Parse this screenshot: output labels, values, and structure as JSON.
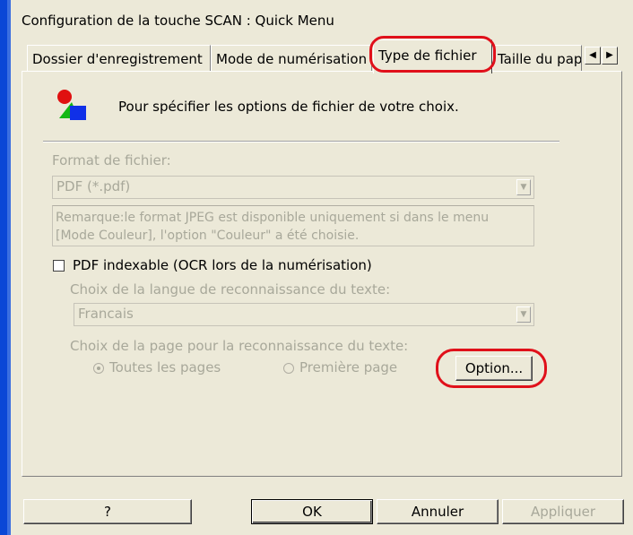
{
  "window": {
    "title": "Configuration de la touche SCAN : Quick Menu"
  },
  "tabs": [
    {
      "label": "Dossier d'enregistrement"
    },
    {
      "label": "Mode de numérisation"
    },
    {
      "label": "Type de fichier",
      "selected": true
    },
    {
      "label": "Taille du papier"
    }
  ],
  "tab_scroll": {
    "left_icon": "arrow-left-icon",
    "right_icon": "arrow-right-icon"
  },
  "panel": {
    "description": "Pour spécifier les options de fichier de votre choix.",
    "file_format": {
      "label": "Format de fichier:",
      "value": "PDF (*.pdf)",
      "enabled": false
    },
    "note": "Remarque:le format JPEG est disponible uniquement si dans le menu [Mode Couleur], l'option \"Couleur\" a été choisie.",
    "pdf_indexable": {
      "label": "PDF indexable (OCR lors de la numérisation)",
      "checked": false
    },
    "ocr_language": {
      "label": "Choix de la langue de reconnaissance du texte:",
      "value": "Francais",
      "enabled": false
    },
    "page_choice": {
      "label": "Choix de la page pour la reconnaissance du texte:",
      "options": [
        {
          "label": "Toutes les pages",
          "selected": true
        },
        {
          "label": "Première page",
          "selected": false
        }
      ],
      "enabled": false
    },
    "option_button": "Option..."
  },
  "buttons": {
    "help": "?",
    "ok": "OK",
    "cancel": "Annuler",
    "apply": "Appliquer"
  },
  "colors": {
    "dialog_bg": "#ece9d8",
    "highlight": "#e0101a",
    "window_frame": "#0a47d6",
    "disabled_text": "#a8a89a"
  }
}
